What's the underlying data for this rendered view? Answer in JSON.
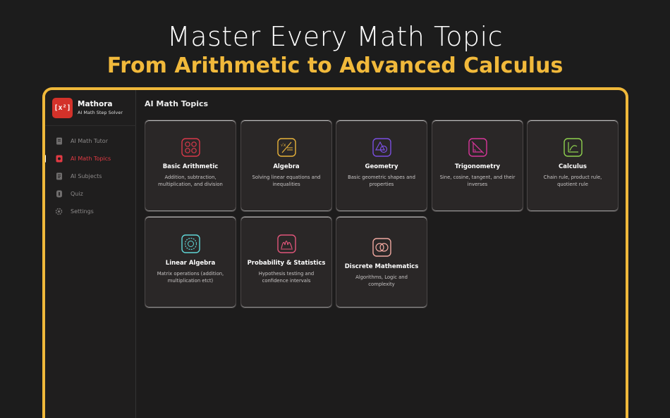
{
  "hero": {
    "title": "Master Every Math Topic",
    "subtitle": "From Arithmetic to Advanced Calculus"
  },
  "app": {
    "name": "Mathora",
    "tagline": "AI Math Step Solver",
    "logo_text": "[x²]",
    "accent_color": "#efb83a",
    "active_color": "#e23a43"
  },
  "sidebar": {
    "items": [
      {
        "label": "AI Math Tutor",
        "icon": "book-icon"
      },
      {
        "label": "AI Math Topics",
        "icon": "topics-icon"
      },
      {
        "label": "AI Subjects",
        "icon": "subjects-icon"
      },
      {
        "label": "Quiz",
        "icon": "quiz-icon"
      },
      {
        "label": "Settings",
        "icon": "gear-icon"
      }
    ],
    "active": "AI Math Topics"
  },
  "main": {
    "title": "AI Math Topics",
    "topics": [
      {
        "title": "Basic Arithmetic",
        "desc": "Addition, subtraction, multiplication, and division",
        "icon": "arithmetic-icon",
        "color": "#d8394a"
      },
      {
        "title": "Algebra",
        "desc": "Solving linear equations and inequalities",
        "icon": "algebra-icon",
        "color": "#e8b33a"
      },
      {
        "title": "Geometry",
        "desc": "Basic geometric shapes and properties",
        "icon": "geometry-icon",
        "color": "#7a4fe0"
      },
      {
        "title": "Trigonometry",
        "desc": "Sine, cosine, tangent, and their inverses",
        "icon": "trigonometry-icon",
        "color": "#d8369a"
      },
      {
        "title": "Calculus",
        "desc": "Chain rule, product rule, quotient rule",
        "icon": "calculus-icon",
        "color": "#8fd14f"
      },
      {
        "title": "Linear Algebra",
        "desc": "Matrix operations (addition, multiplication etct)",
        "icon": "linear-algebra-icon",
        "color": "#5fd6d6"
      },
      {
        "title": "Probability & Statistics",
        "desc": "Hypothesis testing and confidence intervals",
        "icon": "probability-icon",
        "color": "#e0557a"
      },
      {
        "title": "Discrete Mathematics",
        "desc": "Algorithms, Logic and complexity",
        "icon": "discrete-icon",
        "color": "#f0a8a0"
      }
    ]
  }
}
